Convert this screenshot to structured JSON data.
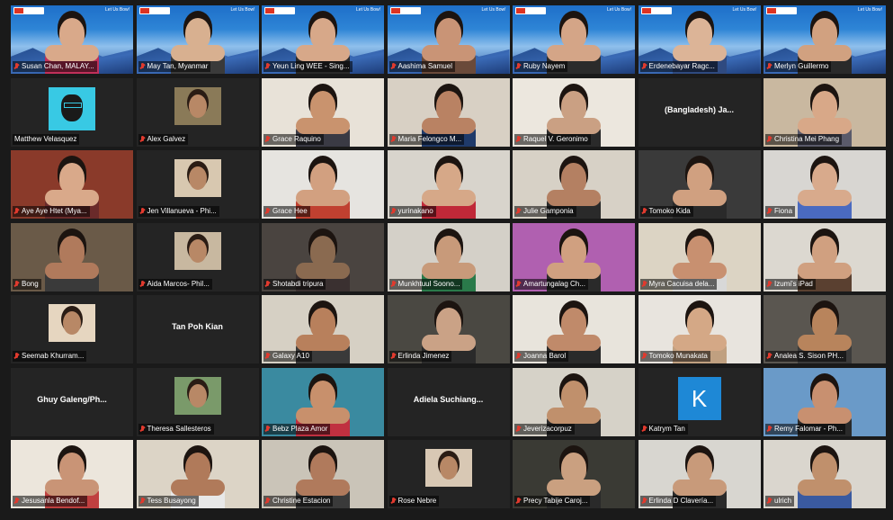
{
  "banner": {
    "logo_text": "",
    "right_text": "Let Us Bow!"
  },
  "participants": [
    {
      "name": "Susan Chan, MALAY...",
      "muted": true,
      "type": "banner",
      "bg": "#2b6fc2",
      "skin": "#d9a98a",
      "shirt": "#c0305a"
    },
    {
      "name": "May Tan, Myanmar",
      "muted": true,
      "type": "banner",
      "bg": "#2b6fc2",
      "skin": "#d8b090",
      "shirt": "#3a3a3a"
    },
    {
      "name": "Yeun Ling WEE - Sing...",
      "muted": true,
      "type": "banner",
      "bg": "#2b6fc2",
      "skin": "#d7a889",
      "shirt": "#2a2a2a"
    },
    {
      "name": "Aashima Samuel",
      "muted": true,
      "type": "banner",
      "bg": "#2b6fc2",
      "skin": "#c99476",
      "shirt": "#6a4a3a"
    },
    {
      "name": "Ruby Nayem",
      "muted": true,
      "type": "banner",
      "bg": "#2b6fc2",
      "skin": "#d4a587",
      "shirt": "#2b2b2b"
    },
    {
      "name": "Erdenebayar Ragc...",
      "muted": true,
      "type": "banner",
      "bg": "#2b6fc2",
      "skin": "#dcb497",
      "shirt": "#2f4a80"
    },
    {
      "name": "Merlyn Guillermo",
      "muted": true,
      "type": "banner",
      "bg": "#2b6fc2",
      "skin": "#d1a180",
      "shirt": "#2a2a2a"
    },
    {
      "name": "Matthew Velasquez",
      "muted": false,
      "type": "avatar",
      "bg": "#242424"
    },
    {
      "name": "Alex Galvez",
      "muted": true,
      "type": "thumb",
      "bg": "#242424",
      "thumb": "#8a7a58"
    },
    {
      "name": "Grace Raquino",
      "muted": true,
      "type": "video",
      "bg": "#e8e2d8",
      "skin": "#c9936e",
      "shirt": "#3a3a44"
    },
    {
      "name": "Maria Felongco M...",
      "muted": true,
      "type": "video",
      "bg": "#d8d0c4",
      "skin": "#b98263",
      "shirt": "#1f3a6a"
    },
    {
      "name": "Raquel V. Geronimo",
      "muted": true,
      "type": "video",
      "bg": "#ece7de",
      "skin": "#caa083",
      "shirt": "#2a2a2a"
    },
    {
      "name": "(Bangladesh) Ja...",
      "muted": false,
      "type": "name",
      "bg": "#242424"
    },
    {
      "name": "Christina Mei Phang",
      "muted": true,
      "type": "video",
      "bg": "#c9b8a0",
      "skin": "#d8a888",
      "shirt": "#5a5a6a"
    },
    {
      "name": "Aye Aye Htet (Mya...",
      "muted": true,
      "type": "video",
      "bg": "#8a3a2a",
      "skin": "#d9a98a",
      "shirt": "#6a2a2a"
    },
    {
      "name": "Jen Villanueva - Phi...",
      "muted": true,
      "type": "thumb",
      "bg": "#242424",
      "thumb": "#d8c8b0"
    },
    {
      "name": "Grace Hee",
      "muted": true,
      "type": "video",
      "bg": "#e6e4e0",
      "skin": "#d2a080",
      "shirt": "#c04030"
    },
    {
      "name": "yurinakano",
      "muted": true,
      "type": "video",
      "bg": "#d8d4cc",
      "skin": "#d6a888",
      "shirt": "#c02838"
    },
    {
      "name": "Julie Gamponia",
      "muted": true,
      "type": "video",
      "bg": "#d7d1c6",
      "skin": "#b48062",
      "shirt": "#2a2a2a"
    },
    {
      "name": "Tomoko Kida",
      "muted": true,
      "type": "video",
      "bg": "#3a3a3a",
      "skin": "#d0a080",
      "shirt": "#2a2a2a"
    },
    {
      "name": "Fiona",
      "muted": true,
      "type": "video",
      "bg": "#d8d6d2",
      "skin": "#d8aa8c",
      "shirt": "#4a6ac0"
    },
    {
      "name": "Bong",
      "muted": true,
      "type": "video",
      "bg": "#6a5a48",
      "skin": "#b07a5c",
      "shirt": "#3a3a3a"
    },
    {
      "name": "Aida Marcos- Phil...",
      "muted": true,
      "type": "thumb",
      "bg": "#242424",
      "thumb": "#c8b8a0"
    },
    {
      "name": "Shotabdi tripura",
      "muted": true,
      "type": "video",
      "bg": "#4a4440",
      "skin": "#8a6a50",
      "shirt": "#3a3030"
    },
    {
      "name": "Munkhtuul Soono...",
      "muted": true,
      "type": "video",
      "bg": "#d4d0c8",
      "skin": "#c89a7a",
      "shirt": "#2a7a4a"
    },
    {
      "name": "Amartungalag Ch...",
      "muted": true,
      "type": "video",
      "bg": "#b060b0",
      "skin": "#d0a080",
      "shirt": "#2a2a2a"
    },
    {
      "name": "Myra Cacuisa dela...",
      "muted": true,
      "type": "video",
      "bg": "#dcd4c4",
      "skin": "#c89070",
      "shirt": "#d8d8d8"
    },
    {
      "name": "Izumi's iPad",
      "muted": true,
      "type": "video",
      "bg": "#dcd8d0",
      "skin": "#d0a080",
      "shirt": "#5a4030"
    },
    {
      "name": "Seemab Khurram...",
      "muted": true,
      "type": "thumb",
      "bg": "#242424",
      "thumb": "#e6d6c0"
    },
    {
      "name": "Tan Poh Kian",
      "muted": false,
      "type": "name",
      "bg": "#242424"
    },
    {
      "name": "Galaxy A10",
      "muted": true,
      "type": "video",
      "bg": "#d6d0c4",
      "skin": "#b8805c",
      "shirt": "#3a3a3a"
    },
    {
      "name": "Erlinda Jimenez",
      "muted": true,
      "type": "video",
      "bg": "#4a4842",
      "skin": "#caa286",
      "shirt": "#2a2a2a"
    },
    {
      "name": "Joanna Barol",
      "muted": true,
      "type": "video",
      "bg": "#e8e4dc",
      "skin": "#c08a6a",
      "shirt": "#2a2a2a"
    },
    {
      "name": "Tomoko Munakata",
      "muted": true,
      "type": "video",
      "bg": "#e8e4de",
      "skin": "#d4a886",
      "shirt": "#c0a080"
    },
    {
      "name": "Analea S. Sison PH...",
      "muted": true,
      "type": "video",
      "bg": "#5a5650",
      "skin": "#b8845c",
      "shirt": "#3a3a3a"
    },
    {
      "name": "Ghuy Galeng/Ph...",
      "muted": false,
      "type": "name",
      "bg": "#242424"
    },
    {
      "name": "Theresa Sallesteros",
      "muted": true,
      "type": "thumb",
      "bg": "#242424",
      "thumb": "#7a9a6a"
    },
    {
      "name": "Bebz Plaza Amor",
      "muted": true,
      "type": "video",
      "bg": "#3a8aa0",
      "skin": "#c8906c",
      "shirt": "#c03040"
    },
    {
      "name": "Adiela Suchiang...",
      "muted": false,
      "type": "name",
      "bg": "#242424"
    },
    {
      "name": "Jeverizacorpuz",
      "muted": true,
      "type": "video",
      "bg": "#d6d2c8",
      "skin": "#c0906c",
      "shirt": "#2a2a2a"
    },
    {
      "name": "Katrym Tan",
      "muted": true,
      "type": "k",
      "bg": "#242424",
      "letter": "K"
    },
    {
      "name": "Remy Falomar - Ph...",
      "muted": true,
      "type": "video",
      "bg": "#6a9ac8",
      "skin": "#c89070",
      "shirt": "#2a2a2a"
    },
    {
      "name": "Jesusanla Bendof...",
      "muted": true,
      "type": "video",
      "bg": "#ece6dc",
      "skin": "#c99476",
      "shirt": "#c04040"
    },
    {
      "name": "Tess Busayong",
      "muted": true,
      "type": "video",
      "bg": "#dcd4c6",
      "skin": "#b07a5a",
      "shirt": "#e8e8e8"
    },
    {
      "name": "Christine Estacion",
      "muted": true,
      "type": "video",
      "bg": "#cac4b8",
      "skin": "#b07a5c",
      "shirt": "#3a3a3a"
    },
    {
      "name": "Rose Nebre",
      "muted": true,
      "type": "thumb",
      "bg": "#242424",
      "thumb": "#d8c8b4"
    },
    {
      "name": "Precy Tabije Caroj...",
      "muted": true,
      "type": "video",
      "bg": "#3a3a34",
      "skin": "#caa080",
      "shirt": "#2a2a2a",
      "speaking": true
    },
    {
      "name": "Erlinda D Clavería...",
      "muted": true,
      "type": "video",
      "bg": "#d8d6d0",
      "skin": "#c89a7a",
      "shirt": "#2a2a2a"
    },
    {
      "name": "ulrich",
      "muted": true,
      "type": "video",
      "bg": "#dad6ce",
      "skin": "#c0906c",
      "shirt": "#3a5aa0"
    }
  ]
}
